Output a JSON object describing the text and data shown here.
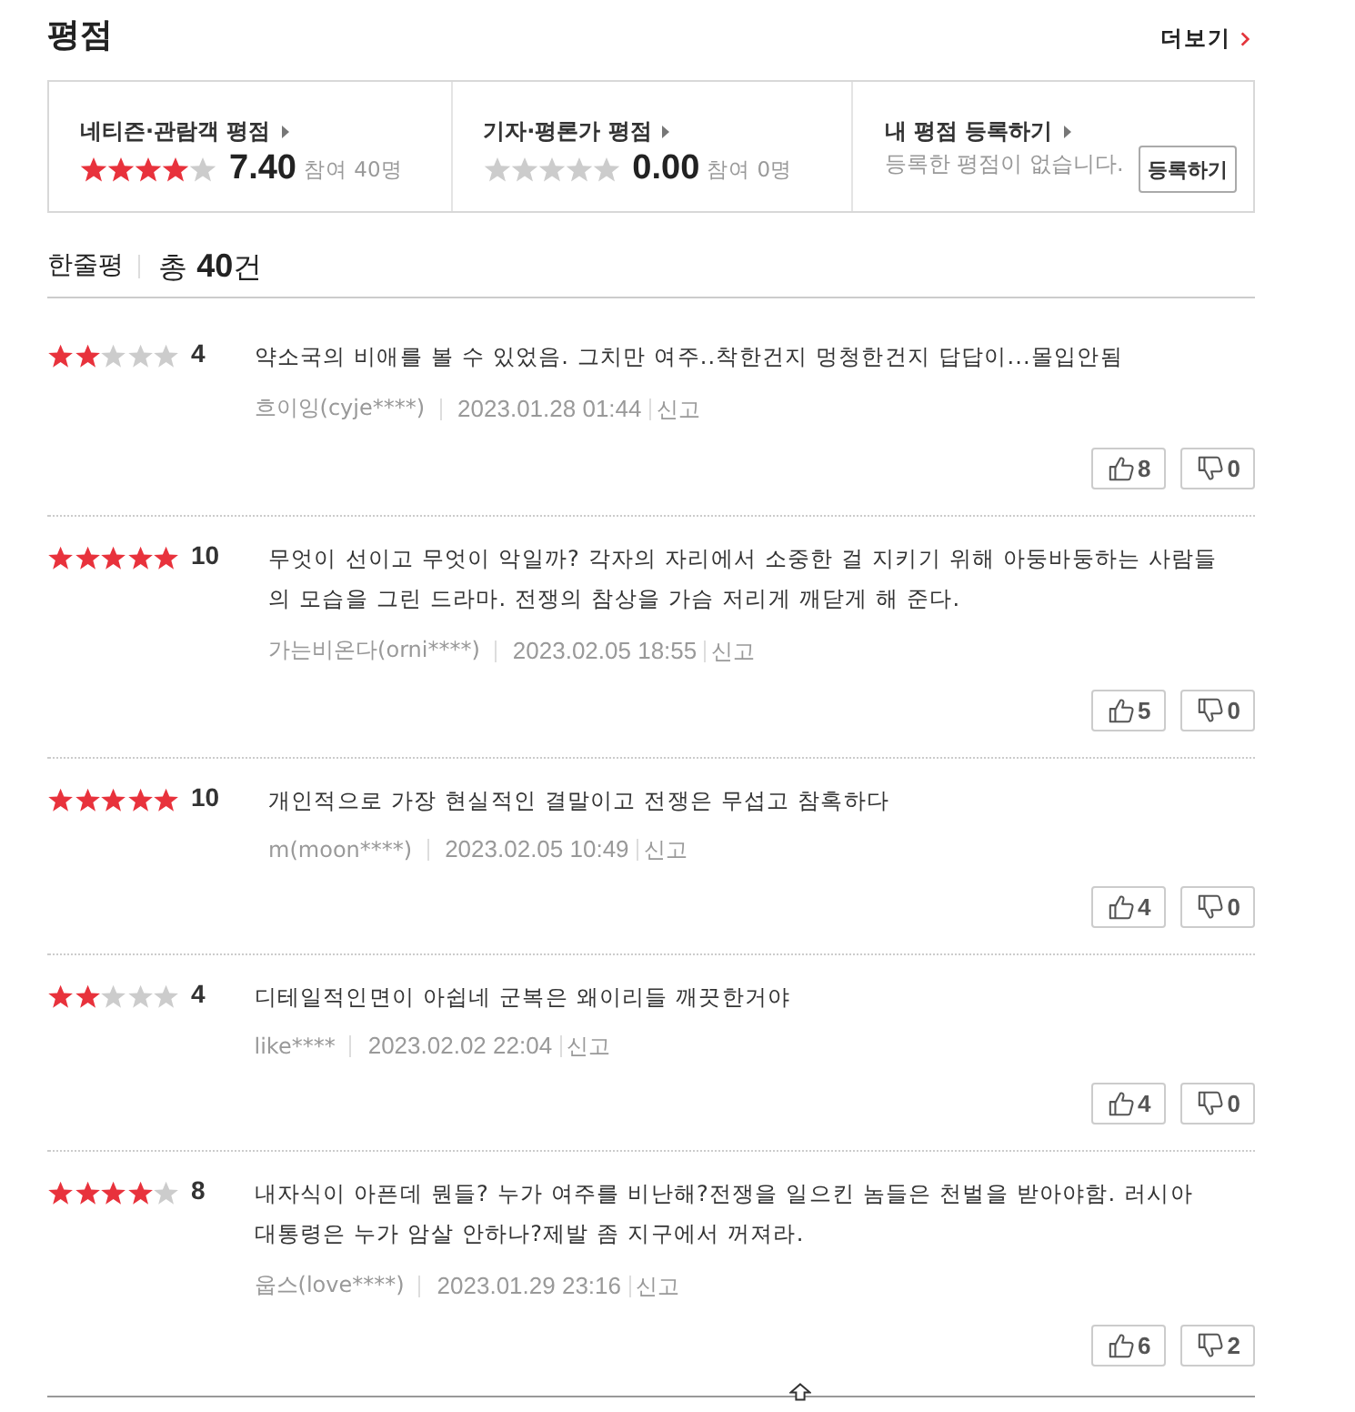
{
  "header": {
    "title": "평점",
    "more_link": "더보기"
  },
  "summary": [
    {
      "kind": "rating",
      "label": "네티즌·관람객 평점",
      "stars": 4,
      "score": "7.40",
      "participants": "참여 40명"
    },
    {
      "kind": "rating",
      "label": "기자·평론가 평점",
      "stars": 0,
      "score": "0.00",
      "participants": "참여 0명"
    },
    {
      "kind": "register",
      "label": "내 평점 등록하기",
      "message": "등록한 평점이 없습니다.",
      "button": "등록하기"
    }
  ],
  "reviews_header": {
    "title": "한줄평",
    "count": "총 **40**건"
  },
  "reviews": [
    {
      "stars": 2,
      "score": "4",
      "text": "약소국의 비애를 볼 수 있었음. 그치만 여주..착한건지 멍청한건지 답답이...몰입안됨",
      "author": "흐이잉(cyje****)",
      "date": "2023.01.28 01:44",
      "report": "신고",
      "likes": "8",
      "dislikes": "0"
    },
    {
      "stars": 5,
      "score": "10",
      "text": "무엇이 선이고 무엇이 악일까? 각자의 자리에서 소중한 걸 지키기 위해 아둥바둥하는 사람들의 모습을 그린 드라마. 전쟁의 참상을 가슴 저리게 깨닫게 해 준다.",
      "author": "가는비온다(orni****)",
      "date": "2023.02.05 18:55",
      "report": "신고",
      "likes": "5",
      "dislikes": "0"
    },
    {
      "stars": 5,
      "score": "10",
      "text": "개인적으로 가장 현실적인 결말이고 전쟁은 무섭고 참혹하다",
      "author": "m(moon****)",
      "date": "2023.02.05 10:49",
      "report": "신고",
      "likes": "4",
      "dislikes": "0"
    },
    {
      "stars": 2,
      "score": "4",
      "text": "디테일적인면이 아쉽네 군복은 왜이리들 깨끗한거야",
      "author": "like****",
      "date": "2023.02.02 22:04",
      "report": "신고",
      "likes": "4",
      "dislikes": "0"
    },
    {
      "stars": 4,
      "score": "8",
      "text": "내자식이 아픈데 뭔들? 누가 여주를 비난해?전쟁을 일으킨 놈들은 천벌을 받아야함. 러시아 대통령은 누가 암살 안하나?제발 좀 지구에서 꺼져라.",
      "author": "웁스(love****)",
      "date": "2023.01.29 23:16",
      "report": "신고",
      "likes": "6",
      "dislikes": "2"
    }
  ]
}
